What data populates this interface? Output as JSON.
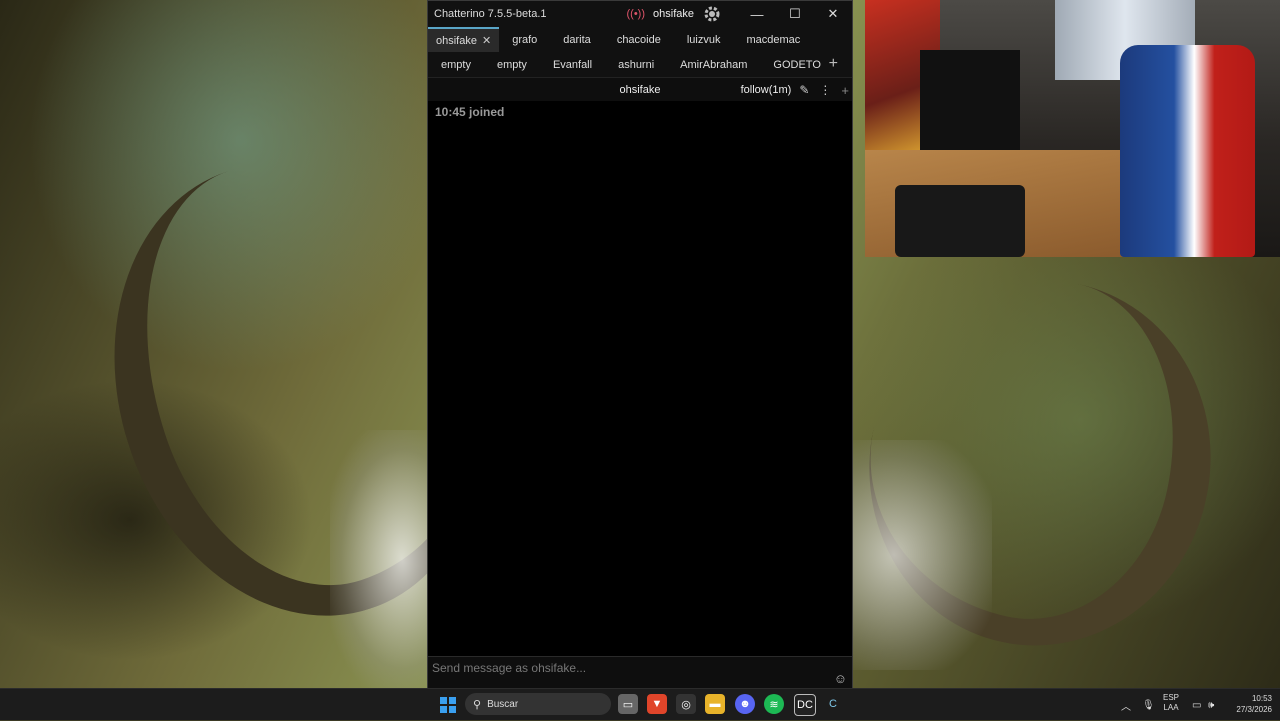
{
  "window": {
    "title": "Chatterino 7.5.5-beta.1",
    "account": "ohsifake",
    "minimize": "—",
    "maximize": "☐",
    "close": "✕"
  },
  "tabs_row1": [
    {
      "label": "ohsifake",
      "selected": true
    },
    {
      "label": "grafo"
    },
    {
      "label": "darita"
    },
    {
      "label": "chacoide"
    },
    {
      "label": "luizvuk"
    },
    {
      "label": "macdemac"
    }
  ],
  "tabs_row2": [
    {
      "label": "empty"
    },
    {
      "label": "empty"
    },
    {
      "label": "Evanfall"
    },
    {
      "label": "ashurni"
    },
    {
      "label": "AmirAbraham"
    },
    {
      "label": "GODETO"
    }
  ],
  "split": {
    "channel": "ohsifake",
    "mode": "follow(1m)"
  },
  "chat": {
    "message": "10:45 joined"
  },
  "input": {
    "placeholder": "Send message as ohsifake..."
  },
  "taskbar": {
    "search_placeholder": "Buscar",
    "apps": [
      "file-explorer-icon",
      "brave-icon",
      "chromium-icon",
      "folder-icon",
      "discord-icon",
      "spotify-icon",
      "dc-icon",
      "chatterino-icon"
    ],
    "lang_line1": "ESP",
    "lang_line2": "LAA",
    "time": "10:53",
    "date": "27/3/2026"
  },
  "colors": {
    "accent_tab": "#5aa6c8",
    "live": "#e0546a",
    "start": "#3aa0f0"
  }
}
